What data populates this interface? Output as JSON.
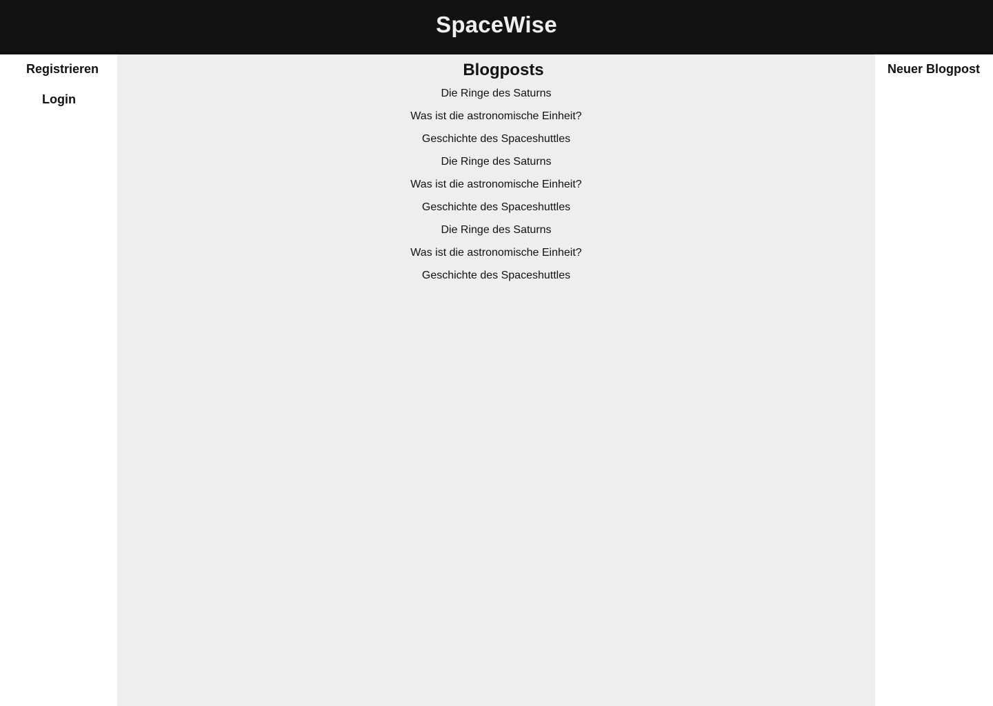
{
  "header": {
    "title": "SpaceWise"
  },
  "left_nav": {
    "register_label": "Registrieren",
    "login_label": "Login"
  },
  "main": {
    "heading": "Blogposts",
    "posts": [
      "Die Ringe des Saturns",
      "Was ist die astronomische Einheit?",
      "Geschichte des Spaceshuttles",
      "Die Ringe des Saturns",
      "Was ist die astronomische Einheit?",
      "Geschichte des Spaceshuttles",
      "Die Ringe des Saturns",
      "Was ist die astronomische Einheit?",
      "Geschichte des Spaceshuttles"
    ]
  },
  "right_nav": {
    "new_post_label": "Neuer Blogpost"
  },
  "colors": {
    "header_background": "#121212",
    "header_text": "#f0f0f0",
    "main_background": "#eeeeee",
    "sidebar_background": "#ffffff"
  }
}
